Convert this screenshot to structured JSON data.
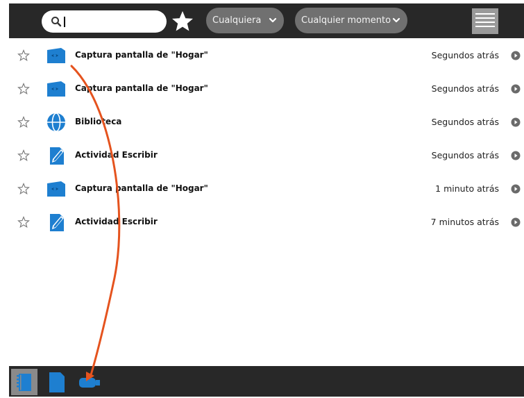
{
  "toolbar": {
    "search": {
      "value": "",
      "placeholder": ""
    },
    "favorite_filter_icon": "star-icon",
    "filter_who": "Cualquiera",
    "filter_when": "Cualquier momento",
    "menu_icon": "menu-icon"
  },
  "entries": [
    {
      "title": "Captura pantalla de \"Hogar\"",
      "time": "Segundos atrás",
      "icon": "image-activity-icon"
    },
    {
      "title": "Captura pantalla de \"Hogar\"",
      "time": "Segundos atrás",
      "icon": "image-activity-icon"
    },
    {
      "title": "Biblioteca",
      "time": "Segundos atrás",
      "icon": "browse-globe-icon"
    },
    {
      "title": "Actividad Escribir",
      "time": "Segundos atrás",
      "icon": "write-activity-icon"
    },
    {
      "title": "Captura pantalla de \"Hogar\"",
      "time": "1 minuto atrás",
      "icon": "image-activity-icon"
    },
    {
      "title": "Actividad Escribir",
      "time": "7 minutos atrás",
      "icon": "write-activity-icon"
    }
  ],
  "bottom_tabs": [
    {
      "icon": "journal-icon",
      "active": true
    },
    {
      "icon": "documents-icon",
      "active": false
    },
    {
      "icon": "usb-drive-icon",
      "active": false
    }
  ],
  "colors": {
    "toolbar_bg": "#282828",
    "pill_bg": "#707070",
    "icon_blue": "#1e7fd0",
    "annotation_arrow": "#e5531e"
  }
}
